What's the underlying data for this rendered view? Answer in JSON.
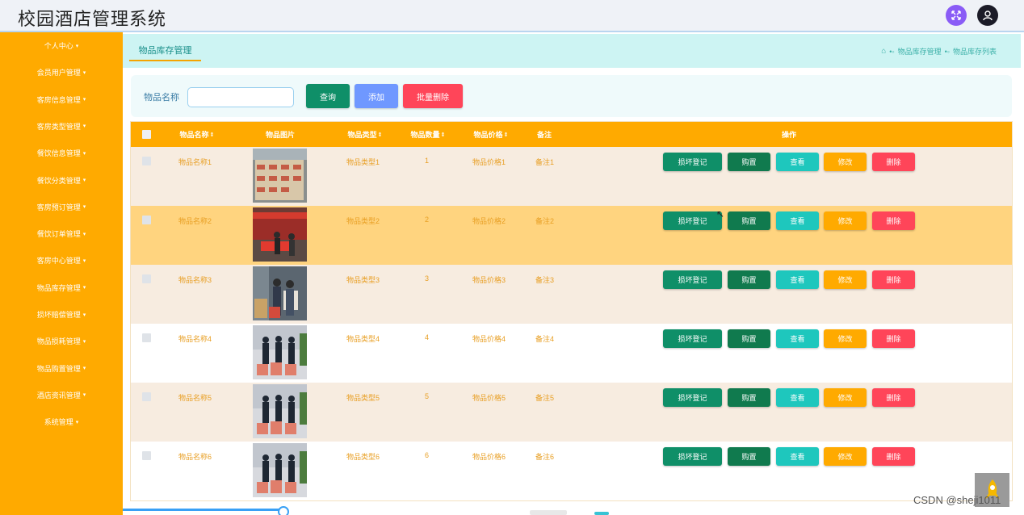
{
  "app": {
    "title": "校园酒店管理系统"
  },
  "header": {
    "icons": [
      "fullscreen-icon",
      "user-icon"
    ]
  },
  "sidebar": {
    "items": [
      {
        "label": "个人中心"
      },
      {
        "label": "会员用户管理"
      },
      {
        "label": "客房信息管理"
      },
      {
        "label": "客房类型管理"
      },
      {
        "label": "餐饮信息管理"
      },
      {
        "label": "餐饮分类管理"
      },
      {
        "label": "客房预订管理"
      },
      {
        "label": "餐饮订单管理"
      },
      {
        "label": "客房中心管理"
      },
      {
        "label": "物品库存管理"
      },
      {
        "label": "损坏赔偿管理"
      },
      {
        "label": "物品损耗管理"
      },
      {
        "label": "物品购置管理"
      },
      {
        "label": "酒店资讯管理"
      },
      {
        "label": "系统管理"
      }
    ]
  },
  "tab": {
    "label": "物品库存管理"
  },
  "breadcrumb": {
    "items": [
      "物品库存管理",
      "物品库存列表"
    ]
  },
  "search": {
    "label": "物品名称",
    "value": "",
    "placeholder": "",
    "query_label": "查询",
    "add_label": "添加",
    "batch_delete_label": "批量删除"
  },
  "table": {
    "headers": {
      "name": "物品名称",
      "image": "物品图片",
      "type": "物品类型",
      "qty": "物品数量",
      "price": "物品价格",
      "remark": "备注",
      "actions": "操作"
    },
    "actions": {
      "damage": "损坏登记",
      "buy": "购置",
      "view": "查看",
      "edit": "修改",
      "delete": "删除"
    },
    "rows": [
      {
        "name": "物品名称1",
        "type": "物品类型1",
        "qty": "1",
        "price": "物品价格1",
        "remark": "备注1"
      },
      {
        "name": "物品名称2",
        "type": "物品类型2",
        "qty": "2",
        "price": "物品价格2",
        "remark": "备注2"
      },
      {
        "name": "物品名称3",
        "type": "物品类型3",
        "qty": "3",
        "price": "物品价格3",
        "remark": "备注3"
      },
      {
        "name": "物品名称4",
        "type": "物品类型4",
        "qty": "4",
        "price": "物品价格4",
        "remark": "备注4"
      },
      {
        "name": "物品名称5",
        "type": "物品类型5",
        "qty": "5",
        "price": "物品价格5",
        "remark": "备注5"
      },
      {
        "name": "物品名称6",
        "type": "物品类型6",
        "qty": "6",
        "price": "物品价格6",
        "remark": "备注6"
      }
    ]
  },
  "colors": {
    "sidebar": "#ffaa00",
    "accent": "#0f8f68",
    "danger": "#ff4559",
    "hover_row": "#ffd47f",
    "stripe_row": "#f7ece0"
  },
  "watermark": "CSDN @sheji1011"
}
